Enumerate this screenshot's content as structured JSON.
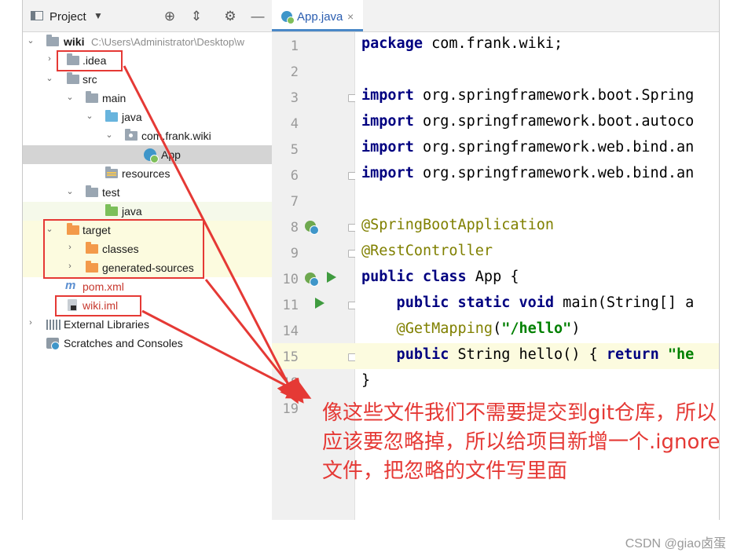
{
  "project_panel": {
    "title": "Project",
    "tree": {
      "root_name": "wiki",
      "root_path": "C:\\Users\\Administrator\\Desktop\\w",
      "idea": ".idea",
      "src": "src",
      "main": "main",
      "java": "java",
      "package": "com.frank.wiki",
      "app": "App",
      "resources": "resources",
      "test": "test",
      "test_java": "java",
      "target": "target",
      "classes": "classes",
      "generated_sources": "generated-sources",
      "pom": "pom.xml",
      "iml": "wiki.iml",
      "external_libraries": "External Libraries",
      "scratches": "Scratches and Consoles"
    }
  },
  "editor": {
    "tab_name": "App.java",
    "lines": [
      {
        "num": "1"
      },
      {
        "num": "2"
      },
      {
        "num": "3"
      },
      {
        "num": "4"
      },
      {
        "num": "5"
      },
      {
        "num": "6"
      },
      {
        "num": "7"
      },
      {
        "num": "8"
      },
      {
        "num": "9"
      },
      {
        "num": "10"
      },
      {
        "num": "11"
      },
      {
        "num": "14"
      },
      {
        "num": "15"
      },
      {
        "num": "18"
      },
      {
        "num": "19"
      }
    ],
    "code": {
      "l1_kw": "package",
      "l1_rest": " com.frank.wiki;",
      "l3_kw": "import",
      "l3_rest": " org.springframework.boot.Spring",
      "l4_kw": "import",
      "l4_rest": " org.springframework.boot.autoco",
      "l5_kw": "import",
      "l5_rest": " org.springframework.web.bind.an",
      "l6_kw": "import",
      "l6_rest": " org.springframework.web.bind.an",
      "l8_ann": "@SpringBootApplication",
      "l9_ann": "@RestController",
      "l10_kw": "public class",
      "l10_rest": " App {",
      "l11_kw": "    public static void",
      "l11_rest": " main(String[] a",
      "l14_ann": "    @GetMapping",
      "l14_p1": "(",
      "l14_str": "\"/hello\"",
      "l14_p2": ")",
      "l15_kw": "    public",
      "l15_rest": " String hello() { ",
      "l15_kw2": "return",
      "l15_str": " \"he",
      "l18": "}"
    }
  },
  "annotation": {
    "note": "像这些文件我们不需要提交到git仓库，所以应该要忽略掉，所以给项目新增一个.ignore文件，把忽略的文件写里面",
    "color": "#e53935"
  },
  "watermark": "CSDN @giao卤蛋"
}
